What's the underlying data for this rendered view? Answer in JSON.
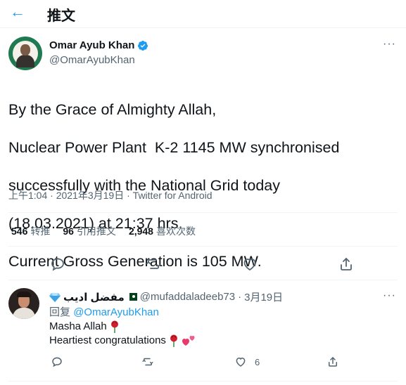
{
  "header": {
    "back_glyph": "←",
    "title": "推文"
  },
  "tweet": {
    "author_name": "Omar Ayub Khan",
    "author_handle": "@OmarAyubKhan",
    "lines": [
      "By the Grace of Almighty Allah,",
      "Nuclear Power Plant  K-2 1145 MW synchronised",
      "successfully with the National Grid today",
      "(18.03.2021) at 21:37 hrs.",
      "Current Gross Generation is 105 MW."
    ],
    "time": "上午1:04",
    "date": "2021年3月19日",
    "separator": " · ",
    "source": "Twitter for Android",
    "stats": {
      "retweets_count": "546",
      "retweets_label": "转推",
      "quotes_count": "96",
      "quotes_label": "引用推文",
      "likes_count": "2,948",
      "likes_label": "喜欢次数"
    },
    "more_glyph": "···"
  },
  "reply": {
    "author_name": "مفضل اديب",
    "handle": "@mufaddaladeeb73",
    "dot": "·",
    "date": "3月19日",
    "reply_to_label": "回复",
    "reply_to_handle": "@OmarAyubKhan",
    "line1": "Masha Allah",
    "line2": "Heartiest congratulations",
    "like_count": "6",
    "more_glyph": "···"
  },
  "icons": {
    "back": "arrow-left-icon",
    "verified": "verified-badge-icon",
    "reply": "reply-icon",
    "retweet": "retweet-icon",
    "like": "heart-icon",
    "share": "share-icon",
    "diamond": "diamond-emoji",
    "flag": "pakistan-flag",
    "rose": "rose-emoji",
    "hearts": "two-hearts-emoji"
  },
  "colors": {
    "accent": "#1d9bf0",
    "text": "#0f1419",
    "secondary": "#536471",
    "divider": "#eff3f4",
    "flag_green": "#01411c"
  }
}
